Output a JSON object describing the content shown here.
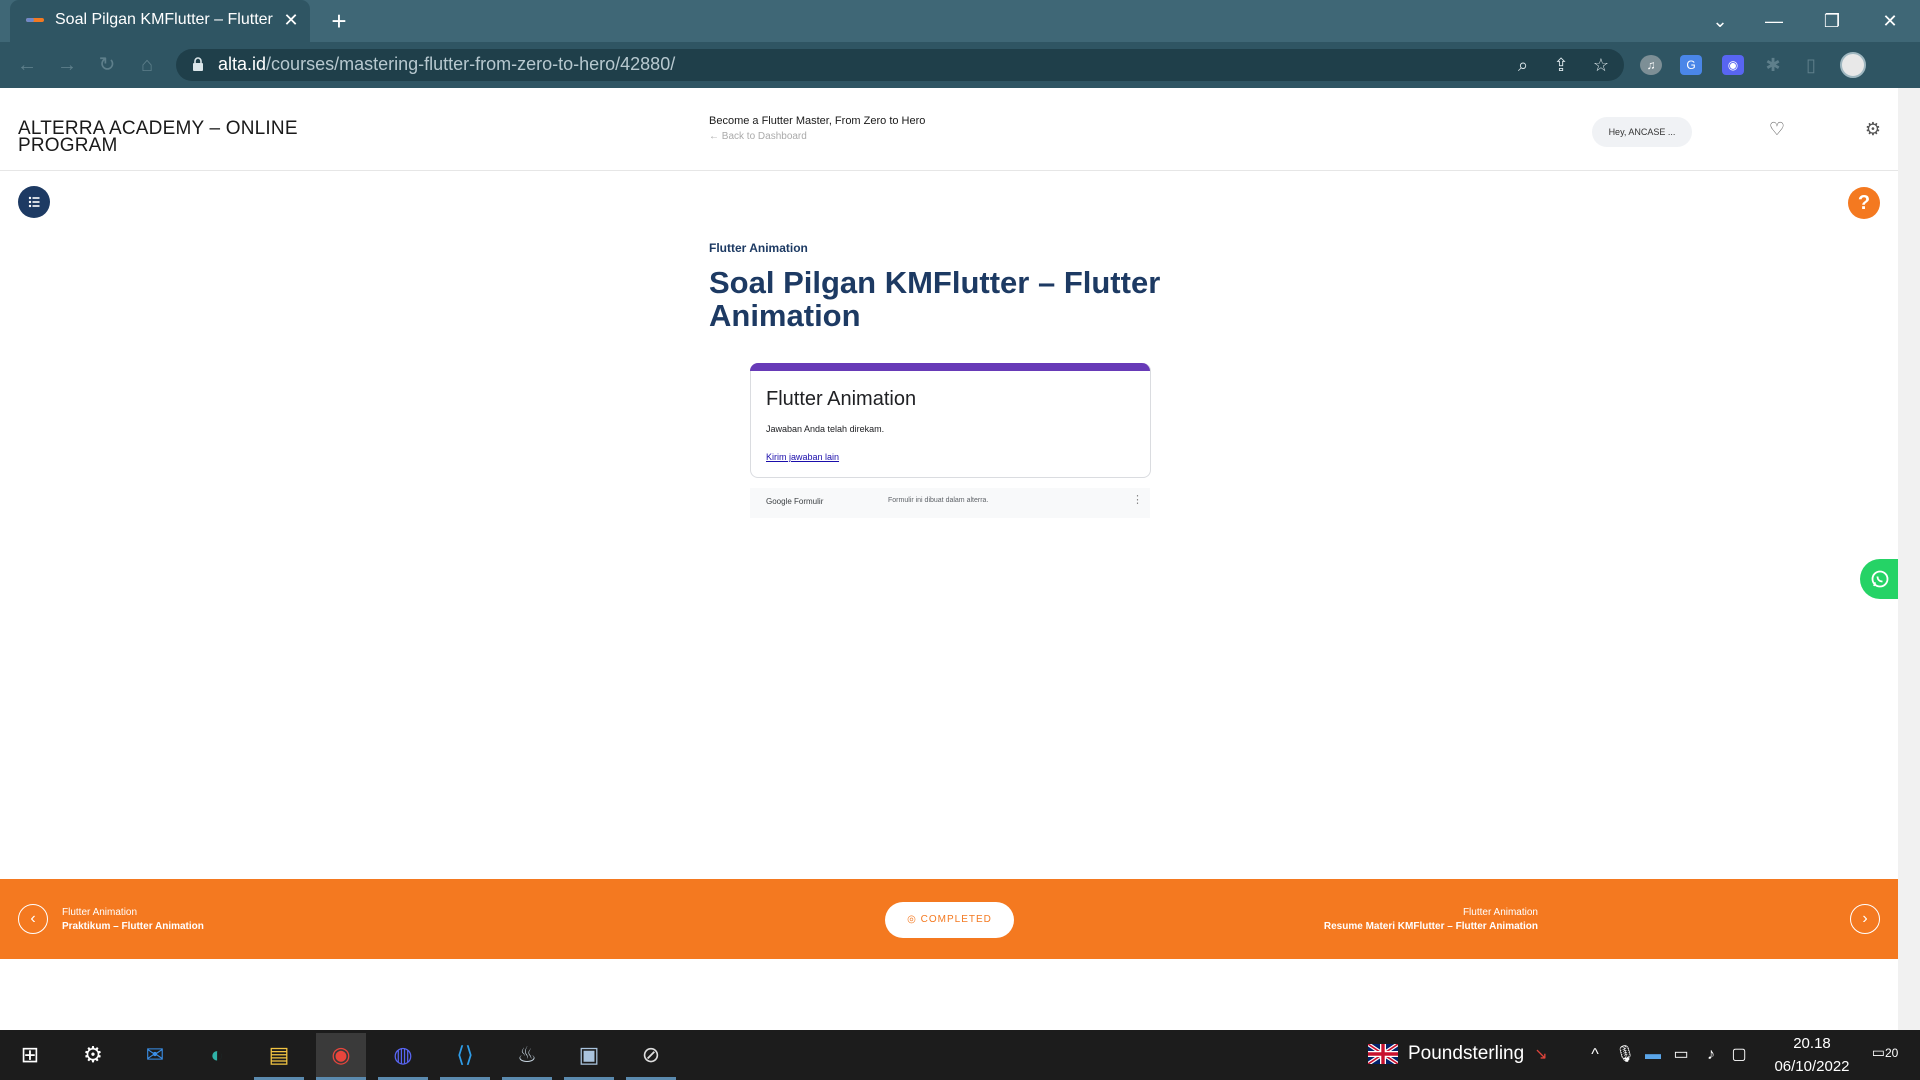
{
  "browser": {
    "tab_title": "Soal Pilgan KMFlutter – Flutter Animation",
    "tab_close": "✕",
    "new_tab": "+",
    "url_host": "alta.id",
    "url_path": "/courses/mastering-flutter-from-zero-to-hero/42880/",
    "controls": {
      "dropdown": "⌄",
      "minimize": "—",
      "restore": "❐",
      "close": "✕"
    }
  },
  "site": {
    "brand": "ALTERRA ACADEMY – ONLINE PROGRAM",
    "course_name": "Become a Flutter Master, From Zero to Hero",
    "back_link": "← Back to Dashboard",
    "user_greeting": "Hey, ANCASE ...",
    "help_label": "?"
  },
  "lesson": {
    "section": "Flutter Animation",
    "title": "Soal Pilgan KMFlutter – Flutter Animation"
  },
  "form": {
    "title": "Flutter Animation",
    "message": "Jawaban Anda telah direkam.",
    "link": "Kirim jawaban lain",
    "brand": "Google Formulir",
    "note": "Formulir ini dibuat dalam alterra.",
    "more": "⋮"
  },
  "bottom_nav": {
    "prev_section": "Flutter Animation",
    "prev_title": "Praktikum – Flutter Animation",
    "complete_label": "COMPLETED",
    "next_section": "Flutter Animation",
    "next_title": "Resume Materi KMFlutter – Flutter Animation"
  },
  "taskbar": {
    "tray_label": "Poundsterling",
    "time": "20.18",
    "date": "06/10/2022",
    "notifications": "20"
  },
  "colors": {
    "brand_navy": "#1d3a63",
    "accent_orange": "#f47920",
    "form_purple": "#673ab7",
    "whatsapp_green": "#25d366",
    "browser_chrome": "#2f5563"
  }
}
